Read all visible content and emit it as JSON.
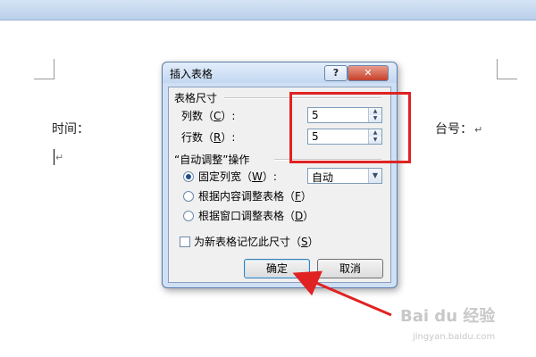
{
  "document": {
    "time_label": "时间：",
    "taihao_label": "台号：",
    "paragraph_mark": "↵"
  },
  "dialog": {
    "title": "插入表格",
    "help_label": "?",
    "close_label": "✕",
    "size_section": "表格尺寸",
    "columns_label_pre": "列数（",
    "columns_hotkey": "C",
    "columns_label_post": "）:",
    "columns_value": "5",
    "rows_label_pre": "行数（",
    "rows_hotkey": "R",
    "rows_label_post": "）:",
    "rows_value": "5",
    "autofit_section": "“自动调整”操作",
    "fixed_width_pre": "固定列宽（",
    "fixed_width_hotkey": "W",
    "fixed_width_post": "）:",
    "fixed_width_value": "自动",
    "autofit_content_pre": "根据内容调整表格（",
    "autofit_content_hotkey": "F",
    "autofit_content_post": "）",
    "autofit_window_pre": "根据窗口调整表格（",
    "autofit_window_hotkey": "D",
    "autofit_window_post": "）",
    "remember_pre": "为新表格记忆此尺寸（",
    "remember_hotkey": "S",
    "remember_post": "）",
    "ok_label": "确定",
    "cancel_label": "取消",
    "selected_option": "fixed-width"
  },
  "watermark": {
    "brand": "Bai du 经验",
    "url": "jingyan.baidu.com"
  },
  "colors": {
    "annotation": "#e02222",
    "dialog_bg": "#cfe0f5"
  }
}
